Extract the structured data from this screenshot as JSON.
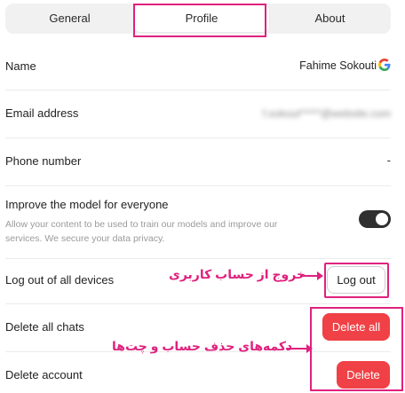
{
  "tabs": [
    {
      "label": "General"
    },
    {
      "label": "Profile"
    },
    {
      "label": "About"
    }
  ],
  "profile": {
    "name_label": "Name",
    "name_value": "Fahime Sokouti",
    "email_label": "Email address",
    "email_value": "f.sokout*****@website.com",
    "phone_label": "Phone number",
    "phone_value": "-",
    "improve_label": "Improve the model for everyone",
    "improve_desc": "Allow your content to be used to train our models and improve our services. We secure your data privacy.",
    "improve_enabled": true,
    "logout_label": "Log out of all devices",
    "logout_button": "Log out",
    "delete_chats_label": "Delete all chats",
    "delete_all_button": "Delete all",
    "delete_account_label": "Delete account",
    "delete_button": "Delete"
  },
  "annotations": {
    "logout_note": "خروج از حساب کاربری",
    "delete_note": "دکمه‌های حذف حساب و چت‌ها"
  },
  "colors": {
    "highlight": "#e0217e",
    "danger": "#ef4146",
    "toggle_on": "#2f2f2f"
  },
  "icons": {
    "account_provider": "google-icon"
  }
}
